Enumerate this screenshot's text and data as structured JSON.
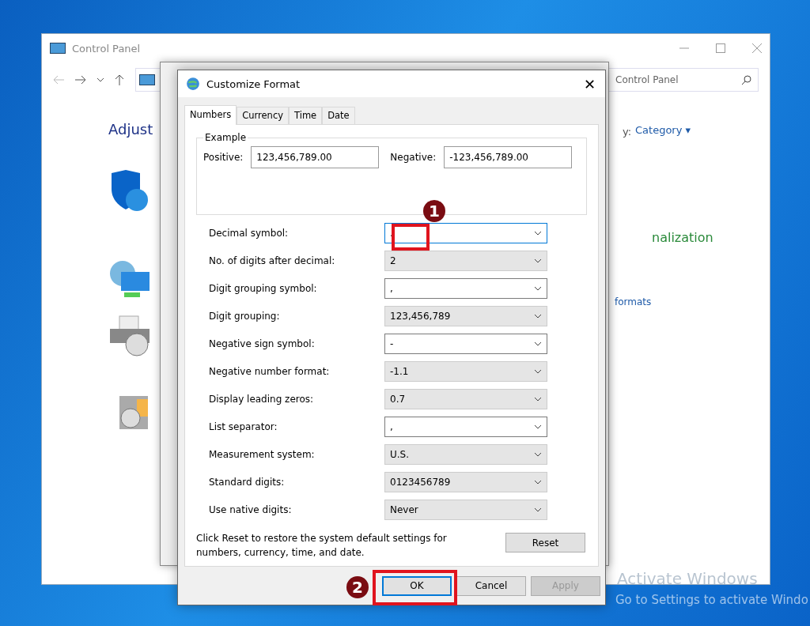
{
  "control_panel": {
    "title": "Control Panel",
    "address_tail": "Control Panel",
    "heading": "Adjust",
    "view_by": "y:",
    "view_value": "Category",
    "view_caret": "▾",
    "links": [
      "nalization",
      "formats"
    ]
  },
  "dialog": {
    "title": "Customize Format",
    "close": "✕",
    "tabs": [
      {
        "label": "Numbers",
        "selected": true
      },
      {
        "label": "Currency",
        "selected": false
      },
      {
        "label": "Time",
        "selected": false
      },
      {
        "label": "Date",
        "selected": false
      }
    ],
    "example": {
      "title": "Example",
      "positive_label": "Positive:",
      "positive": "123,456,789.00",
      "negative_label": "Negative:",
      "negative": "-123,456,789.00"
    },
    "settings": [
      {
        "label": "Decimal symbol:",
        "value": ".",
        "kind": "editable",
        "focused": true
      },
      {
        "label": "No. of digits after decimal:",
        "value": "2",
        "kind": "list",
        "focused": false
      },
      {
        "label": "Digit grouping symbol:",
        "value": ",",
        "kind": "editable",
        "focused": false
      },
      {
        "label": "Digit grouping:",
        "value": "123,456,789",
        "kind": "list",
        "focused": false
      },
      {
        "label": "Negative sign symbol:",
        "value": "-",
        "kind": "editable",
        "focused": false
      },
      {
        "label": "Negative number format:",
        "value": "-1.1",
        "kind": "list",
        "focused": false
      },
      {
        "label": "Display leading zeros:",
        "value": "0.7",
        "kind": "list",
        "focused": false
      },
      {
        "label": "List separator:",
        "value": ",",
        "kind": "editable",
        "focused": false
      },
      {
        "label": "Measurement system:",
        "value": "U.S.",
        "kind": "list",
        "focused": false
      },
      {
        "label": "Standard digits:",
        "value": "0123456789",
        "kind": "list",
        "focused": false
      },
      {
        "label": "Use native digits:",
        "value": "Never",
        "kind": "list",
        "focused": false
      }
    ],
    "reset_note": "Click Reset to restore the system default settings for numbers, currency, time, and date.",
    "reset": "Reset",
    "buttons": [
      {
        "label": "OK",
        "disabled": false
      },
      {
        "label": "Cancel",
        "disabled": false
      },
      {
        "label": "Apply",
        "disabled": true
      }
    ]
  },
  "annotations": [
    "1",
    "2"
  ],
  "activation": {
    "title": "Activate Windows",
    "text": "Go to Settings to activate Windo"
  }
}
